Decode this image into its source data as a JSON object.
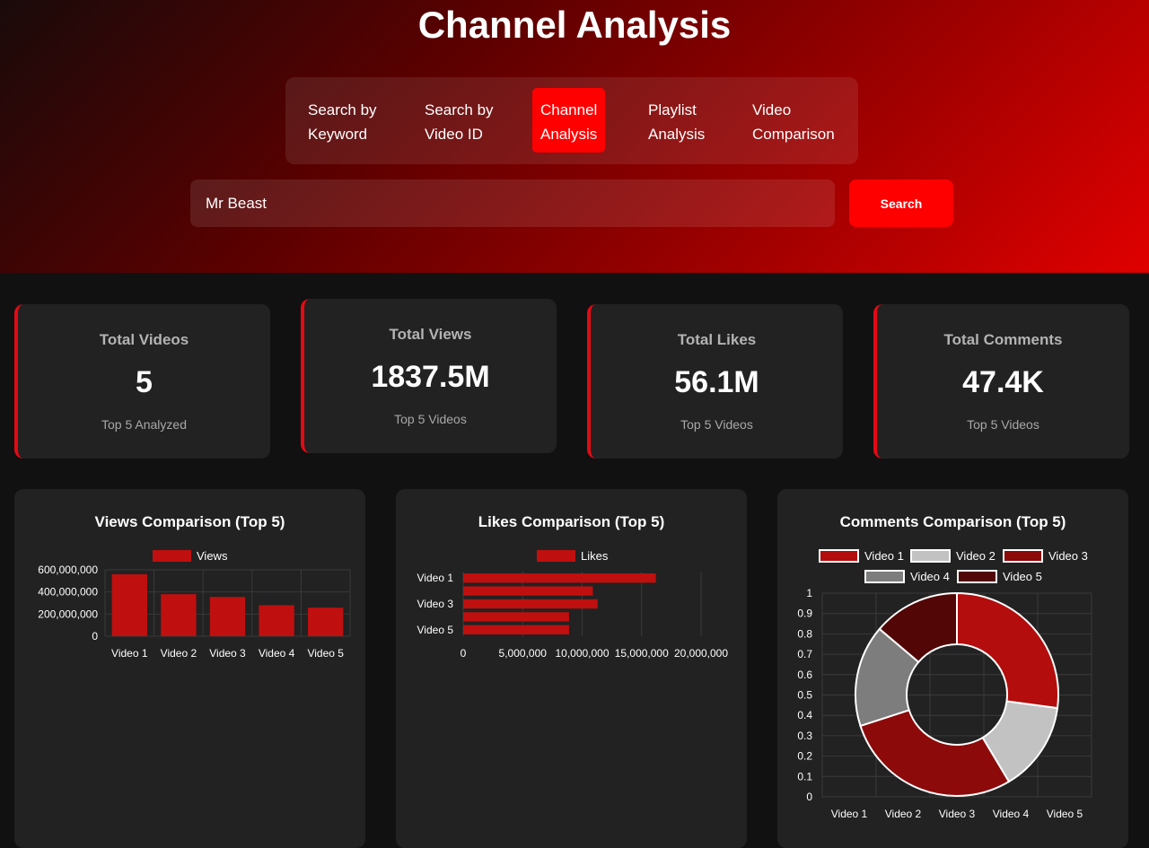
{
  "header": {
    "title": "Channel Analysis"
  },
  "tabs": [
    {
      "line1": "Search by",
      "line2": "Keyword"
    },
    {
      "line1": "Search by",
      "line2": "Video ID"
    },
    {
      "line1": "Channel",
      "line2": "Analysis",
      "active": true
    },
    {
      "line1": "Playlist",
      "line2": "Analysis"
    },
    {
      "line1": "Video",
      "line2": "Comparison"
    }
  ],
  "search": {
    "value": "Mr Beast",
    "button_label": "Search"
  },
  "stats": [
    {
      "title": "Total Videos",
      "value": "5",
      "sub": "Top 5 Analyzed"
    },
    {
      "title": "Total Views",
      "value": "1837.5M",
      "sub": "Top 5 Videos"
    },
    {
      "title": "Total Likes",
      "value": "56.1M",
      "sub": "Top 5 Videos"
    },
    {
      "title": "Total Comments",
      "value": "47.4K",
      "sub": "Top 5 Videos"
    }
  ],
  "colors": {
    "accent": "#ff0000",
    "bar": "#c00f0f",
    "card": "#222222",
    "pie": [
      "#b30d0d",
      "#c2c2c2",
      "#8c0a0a",
      "#7d7d7d",
      "#520606"
    ]
  },
  "chart_data": [
    {
      "type": "bar",
      "title": "Views Comparison (Top 5)",
      "categories": [
        "Video 1",
        "Video 2",
        "Video 3",
        "Video 4",
        "Video 5"
      ],
      "series": [
        {
          "name": "Views",
          "values": [
            560000000,
            380000000,
            355000000,
            280000000,
            258000000
          ]
        }
      ],
      "yticks": [
        "0",
        "200,000,000",
        "400,000,000",
        "600,000,000"
      ],
      "ylim": [
        0,
        600000000
      ],
      "legend": "top",
      "grid": true
    },
    {
      "type": "bar",
      "orientation": "horizontal",
      "title": "Likes Comparison (Top 5)",
      "categories": [
        "Video 1",
        "Video 2",
        "Video 3",
        "Video 4",
        "Video 5"
      ],
      "category_labels_shown": [
        "Video 1",
        "Video 3",
        "Video 5"
      ],
      "series": [
        {
          "name": "Likes",
          "values": [
            16200000,
            10900000,
            11300000,
            8900000,
            8900000
          ]
        }
      ],
      "xticks": [
        "0",
        "5,000,000",
        "10,000,000",
        "15,000,000",
        "20,000,000"
      ],
      "xlim": [
        0,
        20000000
      ],
      "legend": "top",
      "grid": true
    },
    {
      "type": "pie",
      "variant": "doughnut",
      "title": "Comments Comparison (Top 5)",
      "labels": [
        "Video 1",
        "Video 2",
        "Video 3",
        "Video 4",
        "Video 5"
      ],
      "values": [
        28.5,
        15,
        30,
        17,
        14.5
      ],
      "axis_yticks": [
        "0",
        "0.1",
        "0.2",
        "0.3",
        "0.4",
        "0.5",
        "0.6",
        "0.7",
        "0.8",
        "0.9",
        "1"
      ],
      "axis_xticks": [
        "Video 1",
        "Video 2",
        "Video 3",
        "Video 4",
        "Video 5"
      ],
      "legend": "top",
      "grid": true
    }
  ]
}
